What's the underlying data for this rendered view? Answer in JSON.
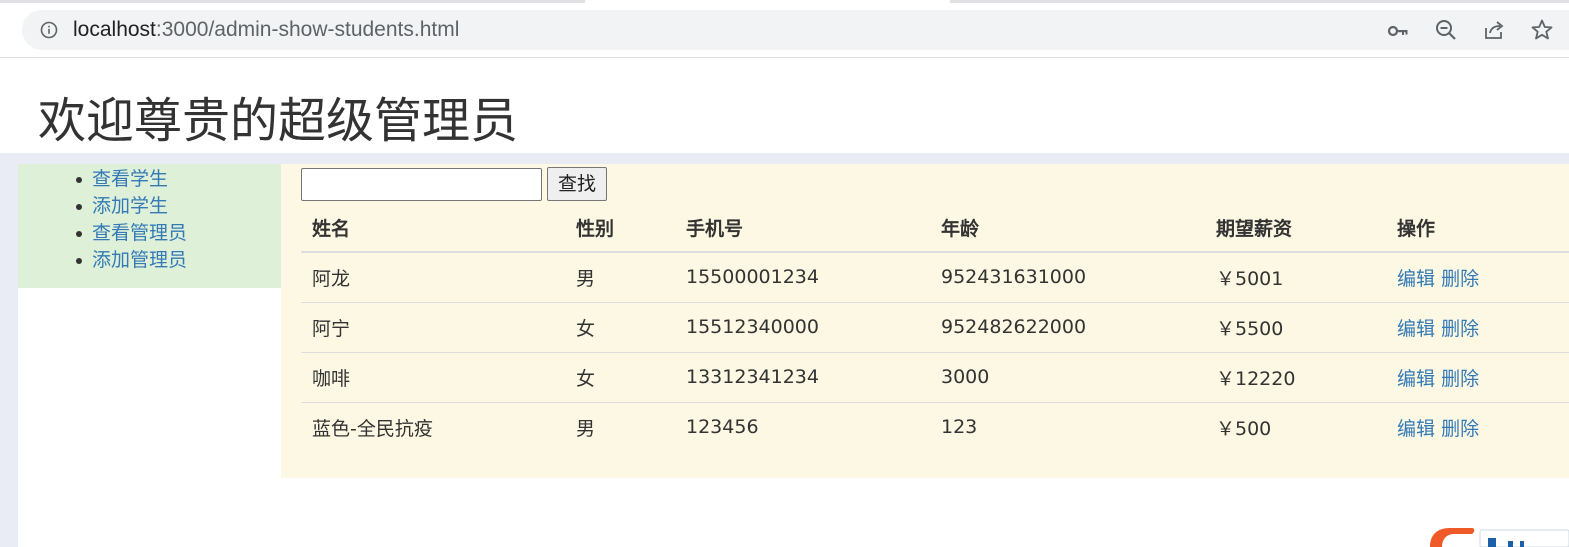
{
  "browser": {
    "url_host": "localhost",
    "url_rest": ":3000/admin-show-students.html"
  },
  "header": {
    "title": "欢迎尊贵的超级管理员"
  },
  "sidebar": {
    "items": [
      {
        "label": "查看学生"
      },
      {
        "label": "添加学生"
      },
      {
        "label": "查看管理员"
      },
      {
        "label": "添加管理员"
      }
    ]
  },
  "search": {
    "value": "",
    "button_label": "查找"
  },
  "table": {
    "columns": [
      "姓名",
      "性别",
      "手机号",
      "年龄",
      "期望薪资",
      "操作"
    ],
    "rows": [
      {
        "name": "阿龙",
        "gender": "男",
        "phone": "15500001234",
        "age": "952431631000",
        "salary": "￥5001",
        "edit": "编辑",
        "delete": "删除"
      },
      {
        "name": "阿宁",
        "gender": "女",
        "phone": "15512340000",
        "age": "952482622000",
        "salary": "￥5500",
        "edit": "编辑",
        "delete": "删除"
      },
      {
        "name": "咖啡",
        "gender": "女",
        "phone": "13312341234",
        "age": "3000",
        "salary": "￥12220",
        "edit": "编辑",
        "delete": "删除"
      },
      {
        "name": "蓝色-全民抗疫",
        "gender": "男",
        "phone": "123456",
        "age": "123",
        "salary": "￥500",
        "edit": "编辑",
        "delete": "删除"
      }
    ]
  },
  "colors": {
    "link": "#337ab7",
    "sidebar_bg": "#dff0d8",
    "main_bg": "#fcf8e3",
    "page_bg": "#e9ebf5"
  },
  "icons": [
    "info-icon",
    "key-icon",
    "zoom-out-icon",
    "share-icon",
    "star-icon"
  ]
}
